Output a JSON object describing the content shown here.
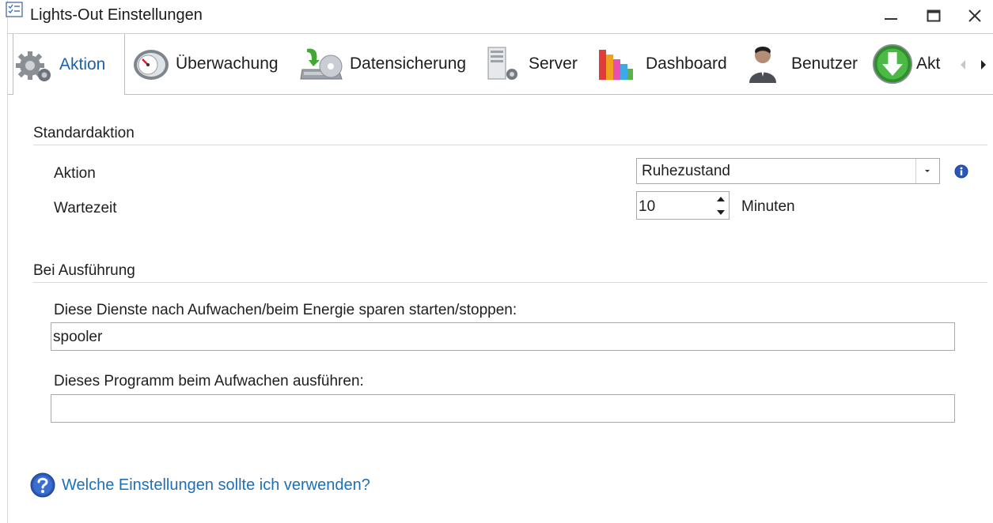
{
  "window": {
    "title": "Lights-Out Einstellungen",
    "icon": "checklist-icon",
    "controls": {
      "minimize": "minimize-icon",
      "maximize": "maximize-icon",
      "close": "close-icon"
    }
  },
  "tabs": [
    {
      "label": "Aktion",
      "icon": "gears-icon",
      "active": true
    },
    {
      "label": "Überwachung",
      "icon": "gauge-icon",
      "active": false
    },
    {
      "label": "Datensicherung",
      "icon": "backup-drive-icon",
      "active": false
    },
    {
      "label": "Server",
      "icon": "server-icon",
      "active": false
    },
    {
      "label": "Dashboard",
      "icon": "bar-chart-icon",
      "active": false
    },
    {
      "label": "Benutzer",
      "icon": "user-icon",
      "active": false
    },
    {
      "label": "Akt",
      "icon": "download-arrow-icon",
      "active": false
    }
  ],
  "standard": {
    "section_title": "Standardaktion",
    "aktion_label": "Aktion",
    "aktion_value": "Ruhezustand",
    "wartezeit_label": "Wartezeit",
    "wartezeit_value": "10",
    "wartezeit_unit": "Minuten"
  },
  "execution": {
    "section_title": "Bei Ausführung",
    "services_label": "Diese Dienste nach Aufwachen/beim Energie sparen starten/stoppen:",
    "services_value": "spooler",
    "program_label": "Dieses Programm beim Aufwachen ausführen:",
    "program_value": ""
  },
  "help": {
    "link_text": "Welche Einstellungen sollte ich verwenden?"
  },
  "colors": {
    "accent": "#1a62b0",
    "link": "#1e6fb8",
    "border": "#a9a9a9"
  }
}
